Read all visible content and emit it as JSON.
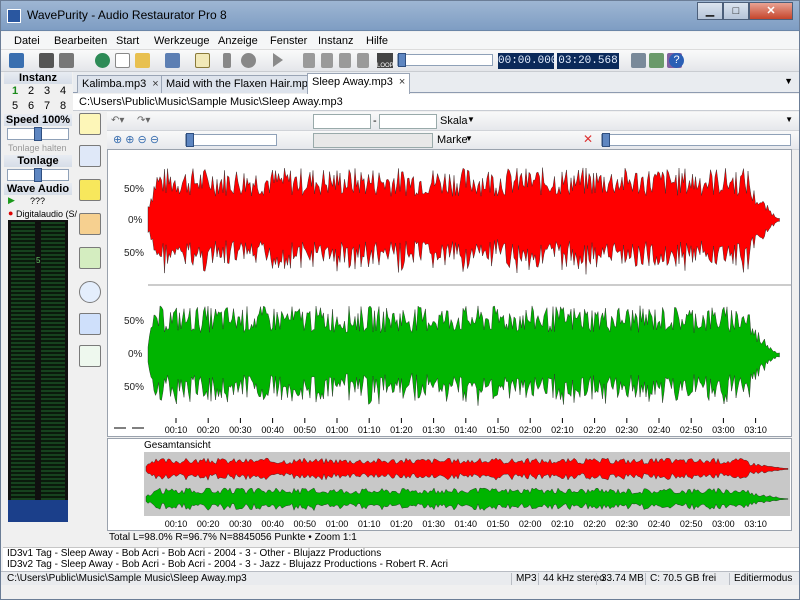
{
  "window": {
    "title": "WavePurity - Audio Restaurator Pro 8"
  },
  "menu": [
    "Datei",
    "Bearbeiten",
    "Start",
    "Werkzeuge",
    "Anzeige",
    "Fenster",
    "Instanz",
    "Hilfe"
  ],
  "toolbar": {
    "time_position": "00:00.000",
    "time_length": "03:20.568",
    "loop_label": "LOOP"
  },
  "left": {
    "instanz_title": "Instanz",
    "instanz_numbers": [
      "1",
      "2",
      "3",
      "4",
      "5",
      "6",
      "7",
      "8"
    ],
    "speed_label": "Speed 100%",
    "tonlage_halten": "Tonlage halten",
    "tonlage_label": "Tonlage",
    "wave_audio_label": "Wave Audio",
    "wave_audio_value": "???",
    "device_label": "Digitalaudio (S/",
    "vu_tick": "5"
  },
  "tabs": [
    {
      "label": "Kalimba.mp3",
      "close": "×"
    },
    {
      "label": "Maid with the Flaxen Hair.mp3",
      "close": "×"
    },
    {
      "label": "Sleep Away.mp3",
      "close": "×"
    }
  ],
  "path": "C:\\Users\\Public\\Music\\Sample Music\\Sleep Away.mp3",
  "wavetoolbar": {
    "skala_label": "Skala",
    "marke_label": "Marke",
    "range_dash": "-"
  },
  "channel_scale": [
    "50%",
    "0%",
    "50%"
  ],
  "timeline": [
    "00:10",
    "00:20",
    "00:30",
    "00:40",
    "00:50",
    "01:00",
    "01:10",
    "01:20",
    "01:30",
    "01:40",
    "01:50",
    "02:00",
    "02:10",
    "02:20",
    "02:30",
    "02:40",
    "02:50",
    "03:00",
    "03:10"
  ],
  "overview": {
    "label": "Gesamtansicht"
  },
  "colors": {
    "left_channel": "#ff0000",
    "right_channel": "#00b400",
    "overview_bg": "#c8c8c8"
  },
  "total_line": "Total L=98.0% R=96.7% N=8845056 Punkte • Zoom 1:1",
  "id3": {
    "v1": "ID3v1 Tag - Sleep Away - Bob Acri - Bob Acri - 2004 - 3 - Other - Blujazz Productions",
    "v2": "ID3v2 Tag - Sleep Away - Bob Acri - Bob Acri - 2004 - 3 - Jazz - Blujazz Productions - Robert R. Acri"
  },
  "statusbar": {
    "path": "C:\\Users\\Public\\Music\\Sample Music\\Sleep Away.mp3",
    "format": "MP3",
    "rate": "44 kHz stereo",
    "size": "33.74 MB",
    "free": "C:  70.5 GB frei",
    "mode": "Editiermodus"
  }
}
